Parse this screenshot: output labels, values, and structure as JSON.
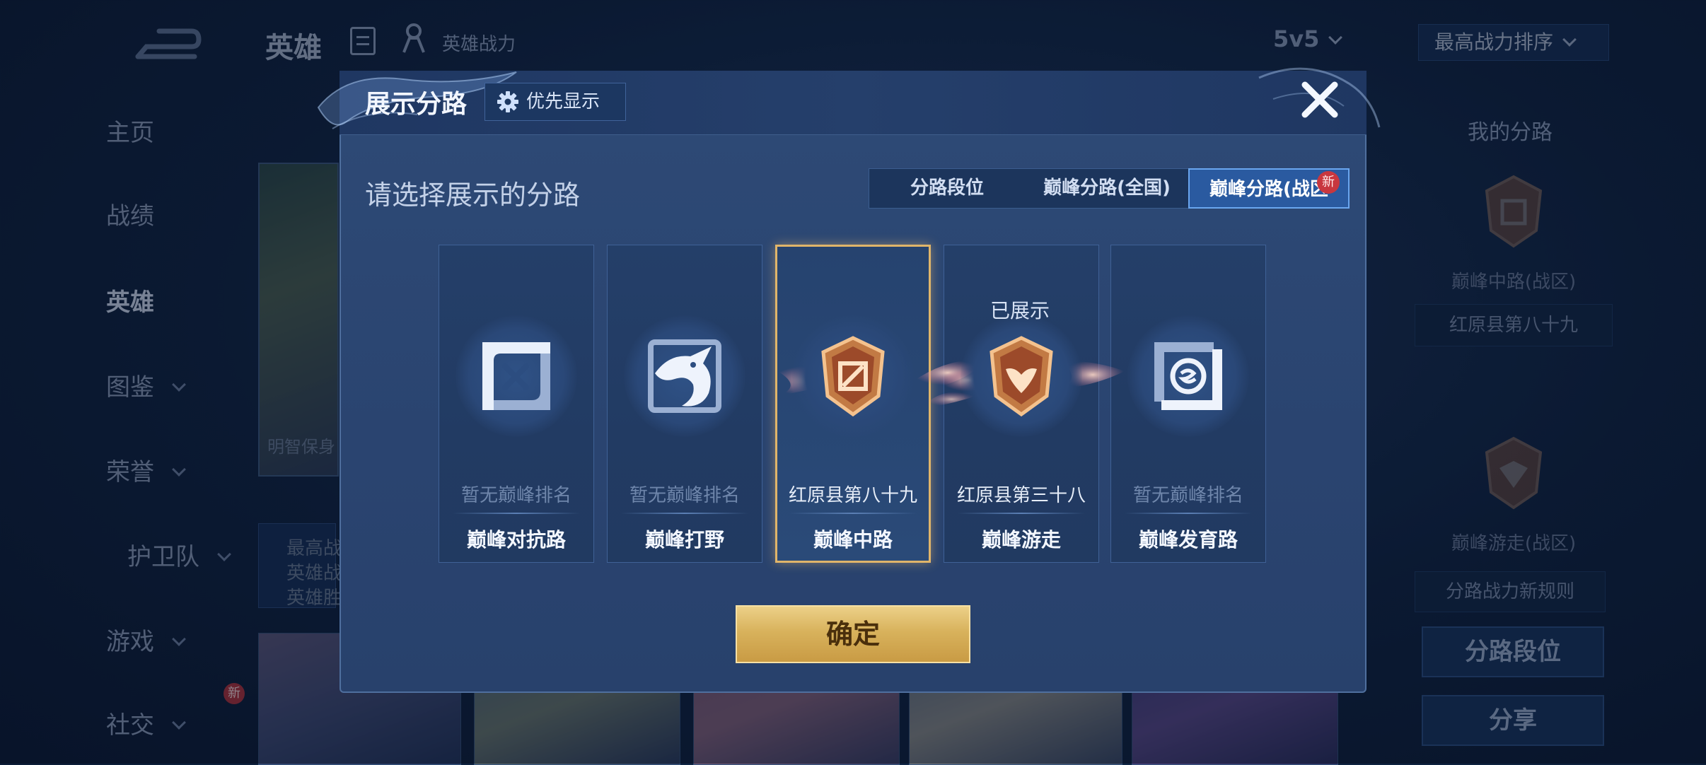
{
  "header": {
    "title": "英雄",
    "power_label": "英雄战力",
    "mode": "5v5",
    "sort": "最高战力排序"
  },
  "sidebar": {
    "items": [
      {
        "label": "主页",
        "has_chevron": false
      },
      {
        "label": "战绩",
        "has_chevron": false
      },
      {
        "label": "英雄",
        "has_chevron": false,
        "active": true
      },
      {
        "label": "图鉴",
        "has_chevron": true
      },
      {
        "label": "荣誉",
        "has_chevron": true
      },
      {
        "label": "护卫队",
        "has_chevron": true
      },
      {
        "label": "游戏",
        "has_chevron": true
      },
      {
        "label": "社交",
        "has_chevron": true,
        "badge": "新"
      }
    ]
  },
  "background_left": {
    "hero_name_partial": "明智保身",
    "stats": [
      "最高战",
      "英雄战",
      "英雄胜"
    ]
  },
  "right_panel": {
    "title": "我的分路",
    "lane1": {
      "label": "巅峰中路(战区)",
      "rank": "红原县第八十九"
    },
    "lane2": {
      "label": "巅峰游走(战区)"
    },
    "rules_label": "分路战力新规则",
    "lane_rank_button": "分路段位",
    "share_button": "分享"
  },
  "modal": {
    "title": "展示分路",
    "priority_button": "优先显示",
    "subtitle": "请选择展示的分路",
    "tabs": [
      {
        "label": "分路段位"
      },
      {
        "label": "巅峰分路(全国)"
      },
      {
        "label": "巅峰分路(战区",
        "active": true,
        "badge": "新"
      }
    ],
    "shown_label": "已展示",
    "lanes": [
      {
        "name": "巅峰对抗路",
        "rank": "暂无巅峰排名",
        "icon": "clash-lane-icon"
      },
      {
        "name": "巅峰打野",
        "rank": "暂无巅峰排名",
        "icon": "dragon-jungle-icon"
      },
      {
        "name": "巅峰中路",
        "rank": "红原县第八十九",
        "icon": "mid-lane-emblem-icon",
        "selected": true
      },
      {
        "name": "巅峰游走",
        "rank": "红原县第三十八",
        "icon": "roam-emblem-icon",
        "shown": true
      },
      {
        "name": "巅峰发育路",
        "rank": "暂无巅峰排名",
        "icon": "farm-lane-icon"
      }
    ],
    "confirm_button": "确定"
  },
  "colors": {
    "accent_gold": "#d8b25c",
    "selected_border": "#e0b56a",
    "tab_active": "#2a5aa0",
    "badge_red": "#c8373f"
  }
}
